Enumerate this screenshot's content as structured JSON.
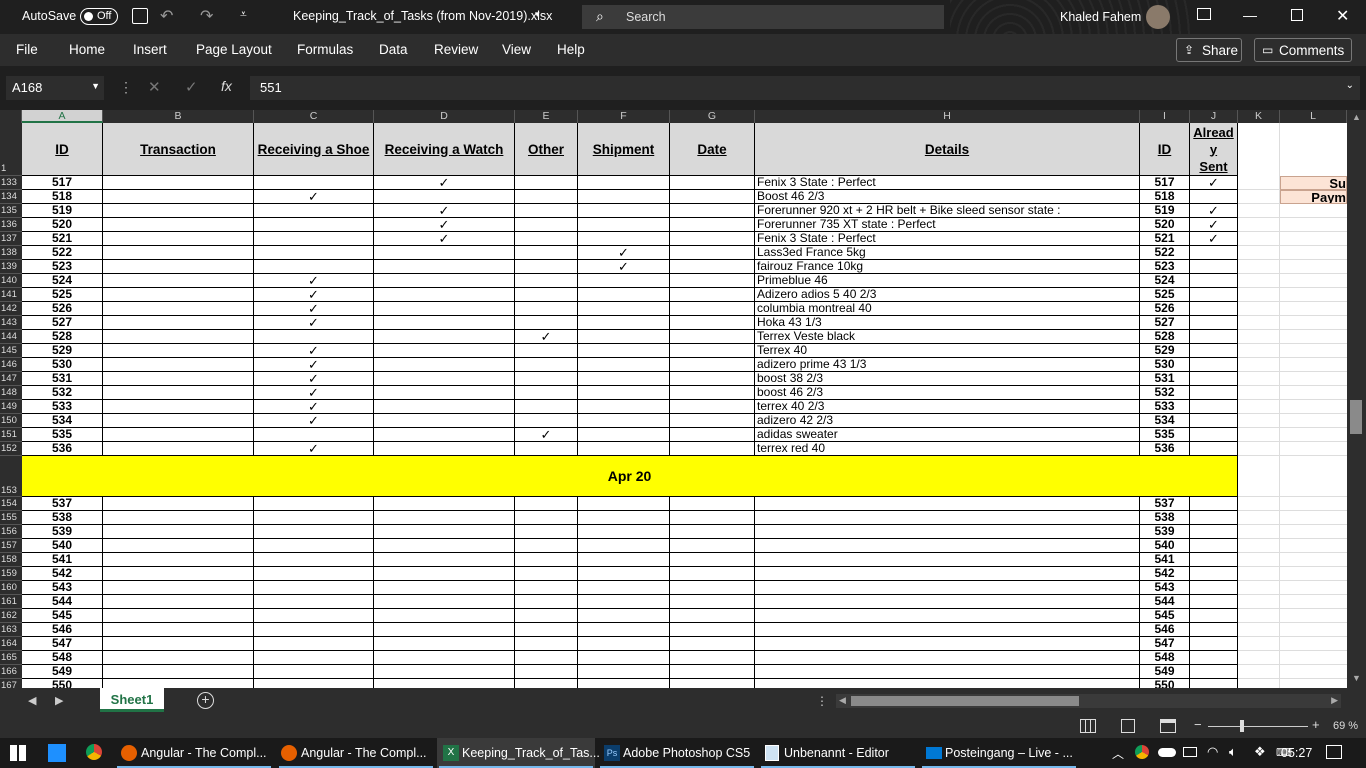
{
  "titlebar": {
    "autosave_label": "AutoSave",
    "toggle_label": "Off",
    "filename": "Keeping_Track_of_Tasks (from Nov-2019).xlsx",
    "search_placeholder": "Search",
    "user": "Khaled Fahem"
  },
  "menu": {
    "items": [
      "File",
      "Home",
      "Insert",
      "Page Layout",
      "Formulas",
      "Data",
      "Review",
      "View",
      "Help"
    ],
    "share": "Share",
    "comments": "Comments"
  },
  "formula": {
    "namebox": "A168",
    "fx": "fx",
    "value": "551"
  },
  "columns": [
    "A",
    "B",
    "C",
    "D",
    "E",
    "F",
    "G",
    "H",
    "I",
    "J",
    "K",
    "L"
  ],
  "headers": {
    "row": "1",
    "id": "ID",
    "transaction": "Transaction",
    "receiving_shoe": "Receiving a Shoe",
    "receiving_watch": "Receiving a Watch",
    "other": "Other",
    "shipment": "Shipment",
    "date": "Date",
    "details": "Details",
    "id2": "ID",
    "already_sent": [
      "Alread",
      "y",
      "Sent"
    ]
  },
  "side": {
    "s1": "Su",
    "s2": "Paym"
  },
  "rows": [
    {
      "r": "133",
      "id": "517",
      "shoe": "",
      "watch": "✓",
      "other": "",
      "ship": "",
      "det": "Fenix 3    State : Perfect",
      "sent": "✓"
    },
    {
      "r": "134",
      "id": "518",
      "shoe": "✓",
      "watch": "",
      "other": "",
      "ship": "",
      "det": "Boost   46 2/3",
      "sent": ""
    },
    {
      "r": "135",
      "id": "519",
      "shoe": "",
      "watch": "✓",
      "other": "",
      "ship": "",
      "det": "Forerunner 920 xt + 2 HR belt + Bike sleed sensor    state :",
      "sent": "✓"
    },
    {
      "r": "136",
      "id": "520",
      "shoe": "",
      "watch": "✓",
      "other": "",
      "ship": "",
      "det": "Forerunner   735 XT    state : Perfect",
      "sent": "✓"
    },
    {
      "r": "137",
      "id": "521",
      "shoe": "",
      "watch": "✓",
      "other": "",
      "ship": "",
      "det": "Fenix 3    State : Perfect",
      "sent": "✓"
    },
    {
      "r": "138",
      "id": "522",
      "shoe": "",
      "watch": "",
      "other": "",
      "ship": "✓",
      "det": "Lass3ed    France    5kg",
      "sent": ""
    },
    {
      "r": "139",
      "id": "523",
      "shoe": "",
      "watch": "",
      "other": "",
      "ship": "✓",
      "det": "fairouz    France    10kg",
      "sent": ""
    },
    {
      "r": "140",
      "id": "524",
      "shoe": "✓",
      "watch": "",
      "other": "",
      "ship": "",
      "det": "Primeblue    46",
      "sent": ""
    },
    {
      "r": "141",
      "id": "525",
      "shoe": "✓",
      "watch": "",
      "other": "",
      "ship": "",
      "det": "Adizero adios 5    40 2/3",
      "sent": ""
    },
    {
      "r": "142",
      "id": "526",
      "shoe": "✓",
      "watch": "",
      "other": "",
      "ship": "",
      "det": "columbia montreal     40",
      "sent": ""
    },
    {
      "r": "143",
      "id": "527",
      "shoe": "✓",
      "watch": "",
      "other": "",
      "ship": "",
      "det": "Hoka    43 1/3",
      "sent": ""
    },
    {
      "r": "144",
      "id": "528",
      "shoe": "",
      "watch": "",
      "other": "✓",
      "ship": "",
      "det": "Terrex Veste    black",
      "sent": ""
    },
    {
      "r": "145",
      "id": "529",
      "shoe": "✓",
      "watch": "",
      "other": "",
      "ship": "",
      "det": "Terrex    40",
      "sent": ""
    },
    {
      "r": "146",
      "id": "530",
      "shoe": "✓",
      "watch": "",
      "other": "",
      "ship": "",
      "det": "adizero prime    43 1/3",
      "sent": ""
    },
    {
      "r": "147",
      "id": "531",
      "shoe": "✓",
      "watch": "",
      "other": "",
      "ship": "",
      "det": "boost    38 2/3",
      "sent": ""
    },
    {
      "r": "148",
      "id": "532",
      "shoe": "✓",
      "watch": "",
      "other": "",
      "ship": "",
      "det": "boost    46 2/3",
      "sent": ""
    },
    {
      "r": "149",
      "id": "533",
      "shoe": "✓",
      "watch": "",
      "other": "",
      "ship": "",
      "det": "terrex    40 2/3",
      "sent": ""
    },
    {
      "r": "150",
      "id": "534",
      "shoe": "✓",
      "watch": "",
      "other": "",
      "ship": "",
      "det": "adizero    42 2/3",
      "sent": ""
    },
    {
      "r": "151",
      "id": "535",
      "shoe": "",
      "watch": "",
      "other": "✓",
      "ship": "",
      "det": "adidas      sweater",
      "sent": ""
    },
    {
      "r": "152",
      "id": "536",
      "shoe": "✓",
      "watch": "",
      "other": "",
      "ship": "",
      "det": "terrex    red    40",
      "sent": ""
    }
  ],
  "month_row": {
    "r": "153",
    "label": "Apr 20"
  },
  "rows2": [
    {
      "r": "154",
      "id": "537"
    },
    {
      "r": "155",
      "id": "538"
    },
    {
      "r": "156",
      "id": "539"
    },
    {
      "r": "157",
      "id": "540"
    },
    {
      "r": "158",
      "id": "541"
    },
    {
      "r": "159",
      "id": "542"
    },
    {
      "r": "160",
      "id": "543"
    },
    {
      "r": "161",
      "id": "544"
    },
    {
      "r": "162",
      "id": "545"
    },
    {
      "r": "163",
      "id": "546"
    },
    {
      "r": "164",
      "id": "547"
    },
    {
      "r": "165",
      "id": "548"
    },
    {
      "r": "166",
      "id": "549"
    },
    {
      "r": "167",
      "id": "550"
    }
  ],
  "sheet": {
    "tab": "Sheet1",
    "zoom": "69 %"
  },
  "taskbar": {
    "items": [
      "Angular - The Compl...",
      "Angular - The Compl...",
      "Keeping_Track_of_Tas...",
      "Adobe Photoshop CS5",
      "Unbenannt - Editor",
      "Posteingang – Live - ..."
    ],
    "time": "05:27"
  },
  "colors": {
    "accent_green": "#217346",
    "highlight_yellow": "#ffff00",
    "header_gray": "#d9d9d9",
    "side_peach": "#fce4d6"
  }
}
